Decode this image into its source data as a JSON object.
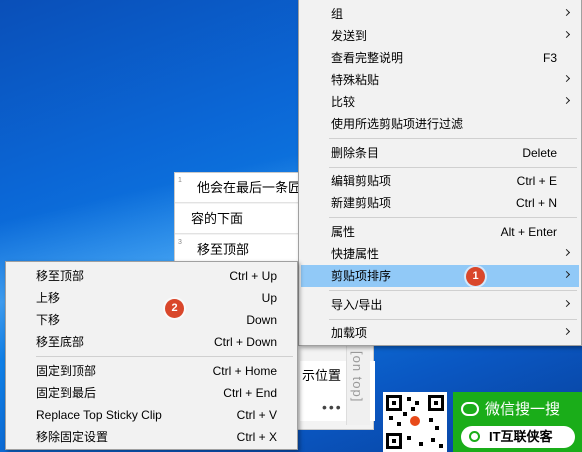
{
  "clipboard_window": {
    "items": [
      {
        "num": "1",
        "text": "他会在最后一条匠"
      },
      {
        "num": "",
        "text": "容的下面"
      },
      {
        "num": "3",
        "text": "移至顶部"
      }
    ],
    "lower_text": "示位置",
    "more": "•••",
    "ontop_label": "[on top]"
  },
  "main_menu": {
    "items": [
      {
        "label": "组",
        "shortcut": "",
        "submenu": true
      },
      {
        "label": "发送到",
        "shortcut": "",
        "submenu": true
      },
      {
        "label": "查看完整说明",
        "shortcut": "F3",
        "submenu": false
      },
      {
        "label": "特殊粘贴",
        "shortcut": "",
        "submenu": true
      },
      {
        "label": "比较",
        "shortcut": "",
        "submenu": true
      },
      {
        "label": "使用所选剪贴项进行过滤",
        "shortcut": "",
        "submenu": false
      },
      {
        "label": "删除条目",
        "shortcut": "Delete",
        "submenu": false
      },
      {
        "label": "编辑剪贴项",
        "shortcut": "Ctrl + E",
        "submenu": false
      },
      {
        "label": "新建剪贴项",
        "shortcut": "Ctrl + N",
        "submenu": false
      },
      {
        "label": "属性",
        "shortcut": "Alt + Enter",
        "submenu": false
      },
      {
        "label": "快捷属性",
        "shortcut": "",
        "submenu": true
      },
      {
        "label": "剪贴项排序",
        "shortcut": "",
        "submenu": true,
        "highlighted": true
      },
      {
        "label": "导入/导出",
        "shortcut": "",
        "submenu": true
      },
      {
        "label": "加载项",
        "shortcut": "",
        "submenu": true
      }
    ]
  },
  "sub_menu": {
    "items": [
      {
        "label": "移至顶部",
        "shortcut": "Ctrl + Up"
      },
      {
        "label": "上移",
        "shortcut": "Up"
      },
      {
        "label": "下移",
        "shortcut": "Down"
      },
      {
        "label": "移至底部",
        "shortcut": "Ctrl + Down"
      },
      {
        "label": "固定到顶部",
        "shortcut": "Ctrl + Home"
      },
      {
        "label": "固定到最后",
        "shortcut": "Ctrl + End"
      },
      {
        "label": "Replace Top Sticky Clip",
        "shortcut": "Ctrl + V"
      },
      {
        "label": "移除固定设置",
        "shortcut": "Ctrl + X"
      }
    ]
  },
  "markers": [
    "1",
    "2"
  ],
  "ad": {
    "title": "微信搜一搜",
    "search_text": "IT互联侠客"
  },
  "colors": {
    "highlight": "#91c9f7",
    "marker": "#d9472b",
    "wechat_green": "#1aad19"
  }
}
